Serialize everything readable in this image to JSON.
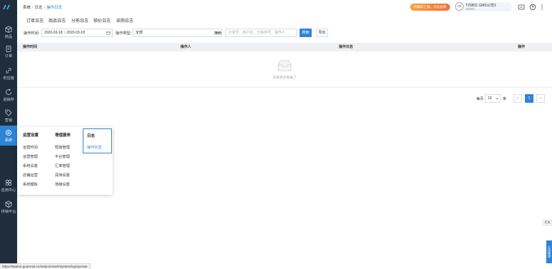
{
  "sidebar": {
    "items": [
      {
        "label": "商品",
        "icon": "box-icon"
      },
      {
        "label": "订单",
        "icon": "clipboard-icon"
      },
      {
        "label": "供应链",
        "icon": "link-icon"
      },
      {
        "label": "进销存",
        "icon": "refresh-icon"
      },
      {
        "label": "营销",
        "icon": "tag-icon"
      },
      {
        "label": "系统",
        "icon": "gear-icon"
      },
      {
        "label": "应用中心",
        "icon": "apps-icon"
      },
      {
        "label": "供销平台",
        "icon": "cube-icon"
      }
    ],
    "active_index": 5
  },
  "header": {
    "breadcrumb": [
      "系统",
      "日志",
      "操作日志"
    ],
    "promo": "待跟踪上线，点击查看",
    "user": {
      "avatar_text": "AN",
      "name": "T29831 GMS公司1",
      "id": "G0001"
    }
  },
  "tabs": [
    "订单日志",
    "商品日志",
    "分拣日志",
    "锁价日志",
    "采购日志"
  ],
  "filters": {
    "time_label": "操作时间:",
    "date_range": "2020-03-18 ~ 2020-03-18",
    "type_label": "操作类型:",
    "type_value": "全部",
    "search_label": "搜索:",
    "search_placeholder": "订单号、商户名、分拣序号、操作人",
    "search_button": "搜索",
    "export_button": "导出"
  },
  "table": {
    "columns": [
      "操作时间",
      "操作人",
      "操作日志",
      "操作"
    ],
    "empty_text": "没有更多数据了"
  },
  "pagination": {
    "per_page_label": "每页",
    "per_page_value": "10",
    "unit": "条",
    "prev": "‹",
    "current": "1",
    "next": "›"
  },
  "flyout": {
    "columns": [
      {
        "heading": "运营设置",
        "items": [
          "运营时间",
          "运营管理",
          "系统设置",
          "店铺运营",
          "系统模板"
        ]
      },
      {
        "heading": "增值服务",
        "items": [
          "短信管理",
          "平台管理",
          "汇率管理",
          "润滑设置",
          "地磅设置"
        ]
      },
      {
        "heading": "日志",
        "items": [
          "操作日志"
        ]
      }
    ]
  },
  "floats": {
    "tag": "任务",
    "blue": "在线客服"
  },
  "statusbar": {
    "url": "https://station.guanmai.cn/station/new#/system/log/operate"
  }
}
